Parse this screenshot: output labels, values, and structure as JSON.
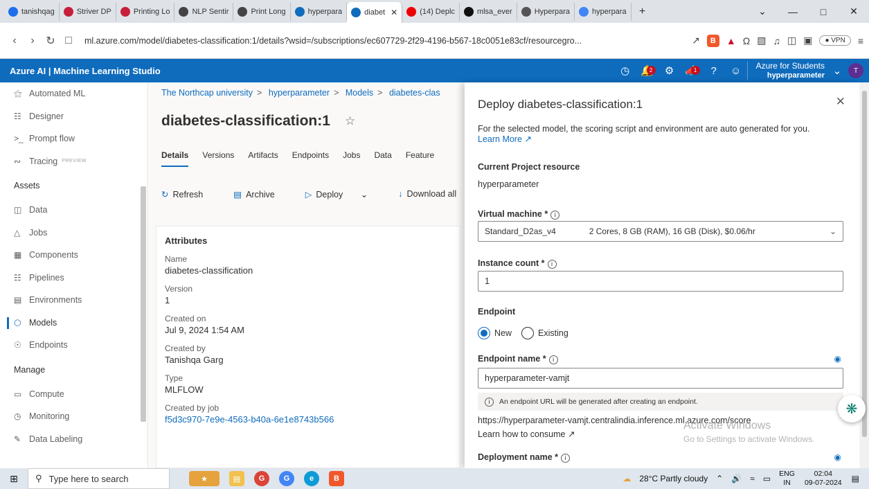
{
  "browser": {
    "tabs": [
      {
        "label": "tanishqag",
        "color": "#1f6feb"
      },
      {
        "label": "Striver DP",
        "color": "#c81e3c"
      },
      {
        "label": "Printing Lo",
        "color": "#c81e3c"
      },
      {
        "label": "NLP Sentir",
        "color": "#444"
      },
      {
        "label": "Print Long",
        "color": "#444"
      },
      {
        "label": "hyperpara",
        "color": "#0f6cbd"
      },
      {
        "label": "diabet",
        "color": "#0f6cbd"
      },
      {
        "label": "(14) Deplc",
        "color": "#e00"
      },
      {
        "label": "mlsa_ever",
        "color": "#111"
      },
      {
        "label": "Hyperpara",
        "color": "#555"
      },
      {
        "label": "hyperpara",
        "color": "#4285f4"
      }
    ],
    "url": "ml.azure.com/model/diabetes-classification:1/details?wsid=/subscriptions/ec607729-2f29-4196-b567-18c0051e83cf/resourcegro...",
    "vpn_label": "VPN"
  },
  "header": {
    "title": "Azure AI | Machine Learning Studio",
    "notif_count": "2",
    "feedback_count": "1",
    "tenant_name": "Azure for Students",
    "workspace": "hyperparameter",
    "avatar_initial": "T"
  },
  "nav": {
    "automated_ml": "Automated ML",
    "designer": "Designer",
    "prompt_flow": "Prompt flow",
    "tracing": "Tracing",
    "tracing_badge": "PREVIEW",
    "assets_header": "Assets",
    "data": "Data",
    "jobs": "Jobs",
    "components": "Components",
    "pipelines": "Pipelines",
    "environments": "Environments",
    "models": "Models",
    "endpoints": "Endpoints",
    "manage_header": "Manage",
    "compute": "Compute",
    "monitoring": "Monitoring",
    "data_labeling": "Data Labeling"
  },
  "main": {
    "breadcrumb": [
      "The Northcap university",
      "hyperparameter",
      "Models",
      "diabetes-clas"
    ],
    "title": "diabetes-classification:1",
    "tabs": [
      "Details",
      "Versions",
      "Artifacts",
      "Endpoints",
      "Jobs",
      "Data",
      "Feature"
    ],
    "commands": {
      "refresh": "Refresh",
      "archive": "Archive",
      "deploy": "Deploy",
      "download": "Download all"
    },
    "attributes_title": "Attributes",
    "attributes": {
      "name_label": "Name",
      "name": "diabetes-classification",
      "version_label": "Version",
      "version": "1",
      "created_on_label": "Created on",
      "created_on": "Jul 9, 2024 1:54 AM",
      "created_by_label": "Created by",
      "created_by": "Tanishqa Garg",
      "type_label": "Type",
      "type": "MLFLOW",
      "job_label": "Created by job",
      "job": "f5d3c970-7e9e-4563-b40a-6e1e8743b566"
    }
  },
  "panel": {
    "title": "Deploy diabetes-classification:1",
    "description": "For the selected model, the scoring script and environment are auto generated for you.",
    "learn_more": "Learn More",
    "project_resource_label": "Current Project resource",
    "project_resource": "hyperparameter",
    "vm_label": "Virtual machine *",
    "vm_value": "Standard_D2as_v4",
    "vm_spec": "2 Cores, 8 GB (RAM), 16 GB (Disk), $0.06/hr",
    "instance_label": "Instance count *",
    "instance_value": "1",
    "endpoint_label": "Endpoint",
    "radio_new": "New",
    "radio_existing": "Existing",
    "endpoint_name_label": "Endpoint name *",
    "endpoint_name": "hyperparameter-vamjt",
    "endpoint_info": "An endpoint URL will be generated after creating an endpoint.",
    "score_url": "https://hyperparameter-vamjt.centralindia.inference.ml.azure.com/score",
    "learn_consume": "Learn how to consume",
    "deployment_name_label": "Deployment name *",
    "watermark_title": "Activate Windows",
    "watermark_sub": "Go to Settings to activate Windows."
  },
  "taskbar": {
    "search_placeholder": "Type here to search",
    "weather": "28°C Partly cloudy",
    "lang": "ENG",
    "region": "IN",
    "time": "02:04",
    "date": "09-07-2024"
  }
}
